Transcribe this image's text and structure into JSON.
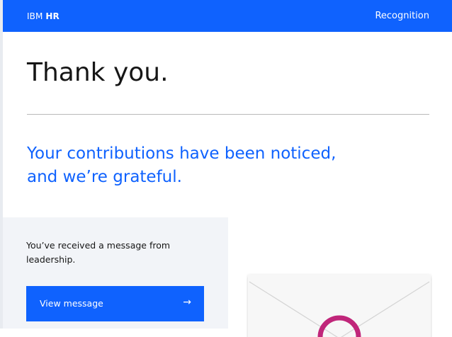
{
  "header": {
    "brand_prefix": "IBM",
    "brand_name": "HR",
    "nav_link": "Recognition"
  },
  "hero": {
    "title": "Thank you.",
    "subtitle": "Your contributions have been noticed, and we’re grateful."
  },
  "message_card": {
    "text": "You’ve received a message from leadership.",
    "button_label": "View message",
    "button_icon": "arrow-right-icon",
    "button_arrow": "→"
  },
  "colors": {
    "brand_blue": "#0f62fe",
    "panel_gray": "#f2f4f8",
    "text": "#161616",
    "envelope_ring": "#c0267a"
  },
  "illustration": {
    "icon": "envelope-icon"
  }
}
